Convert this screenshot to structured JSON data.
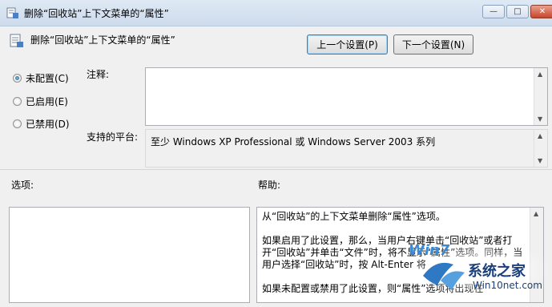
{
  "window": {
    "title": "删除“回收站”上下文菜单的“属性”",
    "controls": {
      "minimize": "—",
      "maximize": "□",
      "close": "✕"
    }
  },
  "header": {
    "title": "删除“回收站”上下文菜单的“属性”",
    "prev_button": "上一个设置(P)",
    "next_button": "下一个设置(N)"
  },
  "options": {
    "not_configured": "未配置(C)",
    "enabled": "已启用(E)",
    "disabled": "已禁用(D)",
    "selected": "not_configured"
  },
  "comment": {
    "label": "注释:",
    "value": ""
  },
  "platform": {
    "label": "支持的平台:",
    "value": "至少 Windows XP Professional 或 Windows Server 2003 系列"
  },
  "sections": {
    "options_label": "选项:",
    "help_label": "帮助:"
  },
  "help": {
    "p1": "从“回收站”的上下文菜单删除“属性”选项。",
    "p2": "如果启用了此设置，那么，当用户右键单击“回收站”或者打开“回收站”并单击“文件”时，将不显示“属性”选项。同样，当用户选择“回收站”时，按 Alt-Enter 将",
    "p3": "如果未配置或禁用了此设置，则“属性”选项将出现在"
  },
  "watermark": {
    "brand": "系统之家",
    "url": "Win10net.com",
    "logo_text": "Win7"
  },
  "colors": {
    "accent": "#3c7fb1",
    "titlebar": "#dfe9f5",
    "close": "#c9452b"
  }
}
